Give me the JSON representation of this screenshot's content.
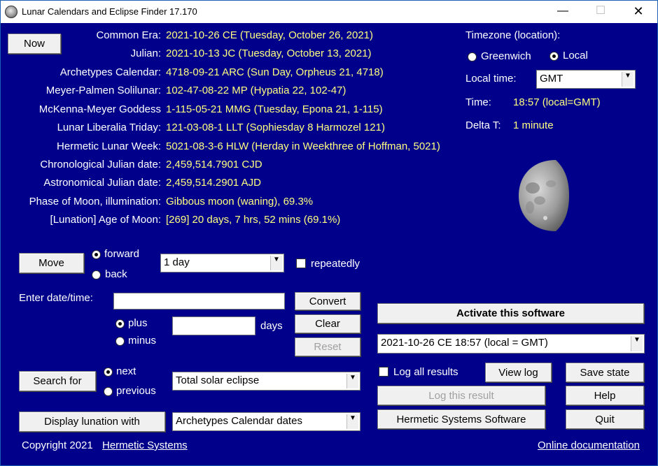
{
  "window": {
    "title": "Lunar Calendars and Eclipse Finder 17.170",
    "minimize": "—",
    "maximize": "☐",
    "close": "✕"
  },
  "now_button": "Now",
  "calendars": [
    {
      "label": "Common Era:",
      "value": "2021-10-26 CE (Tuesday, October 26, 2021)"
    },
    {
      "label": "Julian:",
      "value": "2021-10-13 JC (Tuesday, October 13, 2021)"
    },
    {
      "label": "Archetypes Calendar:",
      "value": "4718-09-21 ARC (Sun Day, Orpheus 21,  4718)"
    },
    {
      "label": "Meyer-Palmen Solilunar:",
      "value": "102-47-08-22 MP (Hypatia 22, 102-47)"
    },
    {
      "label": "McKenna-Meyer Goddess",
      "value": "1-115-05-21 MMG (Tuesday, Epona 21, 1-115)"
    },
    {
      "label": "Lunar Liberalia Triday:",
      "value": "121-03-08-1 LLT (Sophiesday 8 Harmozel 121)"
    },
    {
      "label": "Hermetic Lunar Week:",
      "value": "5021-08-3-6 HLW (Herday in Weekthree of Hoffman, 5021)"
    },
    {
      "label": "Chronological Julian date:",
      "value": "2,459,514.7901 CJD"
    },
    {
      "label": "Astronomical Julian date:",
      "value": "2,459,514.2901 AJD"
    },
    {
      "label": "Phase of Moon, illumination:",
      "value": "Gibbous moon (waning), 69.3%"
    },
    {
      "label": "[Lunation] Age of Moon:",
      "value": "[269] 20 days, 7 hrs, 52 mins (69.1%)"
    }
  ],
  "timezone": {
    "label": "Timezone (location):",
    "greenwich": "Greenwich",
    "local": "Local",
    "selected": "Local",
    "local_time_label": "Local time:",
    "local_time_value": "GMT",
    "time_label": "Time:",
    "time_value": "18:57 (local=GMT)",
    "delta_label": "Delta T:",
    "delta_value": "1 minute"
  },
  "moon": {
    "illumination_percent": 69.3,
    "phase": "waning",
    "icon": "moon-image"
  },
  "move": {
    "button": "Move",
    "forward": "forward",
    "back": "back",
    "selected": "forward",
    "step": "1 day",
    "repeatedly": "repeatedly"
  },
  "enter": {
    "label": "Enter date/time:",
    "value": "",
    "plus": "plus",
    "minus": "minus",
    "selected": "plus",
    "days_value": "",
    "days_label": "days",
    "convert": "Convert",
    "clear": "Clear",
    "reset": "Reset"
  },
  "search": {
    "button": "Search for",
    "next": "next",
    "previous": "previous",
    "selected": "next",
    "target": "Total solar eclipse"
  },
  "display": {
    "button": "Display lunation with",
    "option": "Archetypes Calendar dates"
  },
  "right_panel": {
    "activate": "Activate this software",
    "result_select": "2021-10-26 CE 18:57 (local = GMT)",
    "log_all": "Log all results",
    "view_log": "View log",
    "save_state": "Save state",
    "log_this": "Log this result",
    "help": "Help",
    "hermetic": "Hermetic Systems Software",
    "quit": "Quit"
  },
  "footer": {
    "copyright": "Copyright 2021",
    "company_link": "Hermetic Systems",
    "docs_link": "Online documentation"
  },
  "colors": {
    "background": "#00008b",
    "value_text": "#ffff80",
    "label_text": "#ffffff"
  }
}
